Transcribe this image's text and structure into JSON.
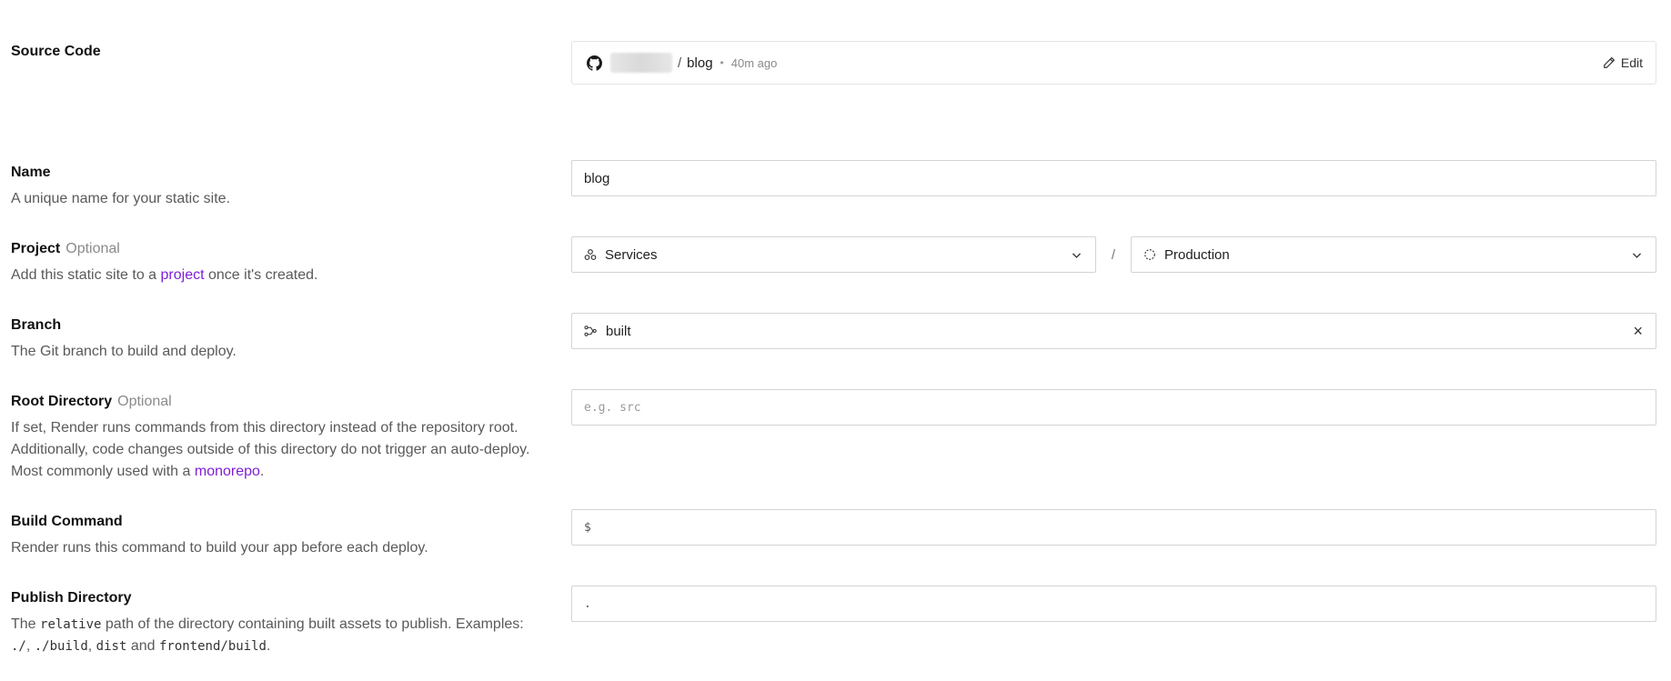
{
  "source_code": {
    "title": "Source Code",
    "repo_separator": "/",
    "repo_name": "blog",
    "dot": "•",
    "time_ago": "40m ago",
    "edit_label": "Edit"
  },
  "name": {
    "title": "Name",
    "description": "A unique name for your static site.",
    "value": "blog"
  },
  "project": {
    "title": "Project",
    "optional": "Optional",
    "desc_before": "Add this static site to a ",
    "desc_link": "project",
    "desc_after": " once it's created.",
    "project_value": "Services",
    "separator": "/",
    "environment_value": "Production"
  },
  "branch": {
    "title": "Branch",
    "description": "The Git branch to build and deploy.",
    "value": "built",
    "clear_glyph": "×"
  },
  "root_directory": {
    "title": "Root Directory",
    "optional": "Optional",
    "line1": "If set, Render runs commands from this directory instead of the repository root.",
    "line2": "Additionally, code changes outside of this directory do not trigger an auto-deploy.",
    "line3_before": "Most commonly used with a ",
    "line3_link": "monorepo",
    "line3_after": ".",
    "placeholder": "e.g. src"
  },
  "build_command": {
    "title": "Build Command",
    "description": "Render runs this command to build your app before each deploy.",
    "prefix": "$"
  },
  "publish_directory": {
    "title": "Publish Directory",
    "desc_the": "The ",
    "desc_code_relative": "relative",
    "desc_mid": " path of the directory containing built assets to publish. Examples:",
    "ex1": "./",
    "comma1": ", ",
    "ex2": "./build",
    "comma2": ", ",
    "ex3": "dist",
    "and": " and ",
    "ex4": "frontend/build",
    "period": ".",
    "value": "."
  },
  "colors": {
    "link": "#7c1fd6",
    "border": "#d4d4d4"
  }
}
